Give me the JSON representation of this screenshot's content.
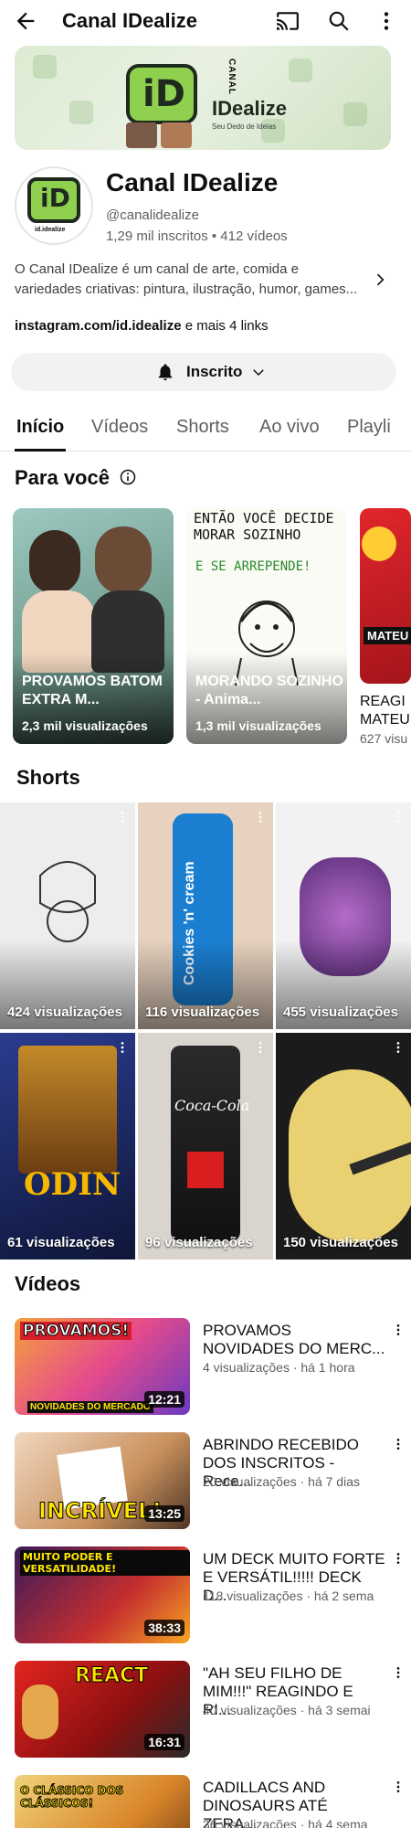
{
  "header": {
    "title": "Canal IDealize"
  },
  "banner": {
    "canal_text": "CANAL",
    "brand": "IDealize",
    "tagline": "Seu Dedo de Ideias"
  },
  "avatar": {
    "mark": "iD",
    "caption": "id.idealize"
  },
  "channel": {
    "name": "Canal IDealize",
    "handle": "@canalidealize",
    "stats": "1,29 mil inscritos • 412 vídeos",
    "description": "O Canal IDealize é um canal de arte, comida e variedades criativas: pintura, ilustração, humor, games...",
    "links_main": "instagram.com/id.idealize",
    "links_more": " e mais 4 links"
  },
  "subscribe": {
    "label": "Inscrito"
  },
  "tabs": [
    {
      "label": "Início"
    },
    {
      "label": "Vídeos"
    },
    {
      "label": "Shorts"
    },
    {
      "label": "Ao vivo"
    },
    {
      "label": "Playli"
    }
  ],
  "for_you": {
    "title": "Para você",
    "cards": [
      {
        "title": "PROVAMOS BATOM EXTRA M...",
        "views": "2,3 mil visualizações"
      },
      {
        "title": "MORANDO SOZINHO - Anima...",
        "views": "1,3 mil visualizações",
        "drawing_text": "ENTÃO VOCÊ DECIDE MORAR SOZINHO",
        "drawing_text2": "E SE ARREPENDE!"
      },
      {
        "title": "REAGI MATEU",
        "views": "627 visu",
        "badge": "MATEU"
      }
    ]
  },
  "shorts": {
    "title": "Shorts",
    "items": [
      {
        "views": "424 visualizações"
      },
      {
        "views": "116 visualizações",
        "label": "Cookies 'n' cream"
      },
      {
        "views": "455 visualizações"
      },
      {
        "views": "61 visualizações",
        "label": "ODIN"
      },
      {
        "views": "96 visualizações",
        "label": "Coca-Cola"
      },
      {
        "views": "150 visualizações"
      }
    ]
  },
  "videos": {
    "title": "Vídeos",
    "items": [
      {
        "thumb_text": "PROVAMOS!",
        "thumb_sub": "NOVIDADES DO MERCADO",
        "duration": "12:21",
        "title": "PROVAMOS NOVIDADES DO MERC...",
        "meta": "4 visualizações · há 1 hora"
      },
      {
        "thumb_text": "INCRÍVEL!",
        "duration": "13:25",
        "title": "ABRINDO RECEBIDO DOS INSCRITOS - Rece...",
        "meta": "20 visualizações · há 7 dias"
      },
      {
        "thumb_text": "MUITO PODER E VERSATILIDADE!",
        "duration": "38:33",
        "title": "UM DECK MUITO FORTE E VERSÁTIL!!!!! DECK D...",
        "meta": "118 visualizações · há 2 sema"
      },
      {
        "thumb_text": "REACT",
        "duration": "16:31",
        "title": "\"AH SEU FILHO DE MIM!!!\" REAGINDO E RI...",
        "meta": "40 visualizações · há 3 semai"
      },
      {
        "thumb_text": "O CLÁSSICO DOS CLÁSSICOS!",
        "duration": "",
        "title": "CADILLACS AND DINOSAURS ATÉ ZERA...",
        "meta": "36 visualizações · há 4 sema"
      }
    ]
  }
}
